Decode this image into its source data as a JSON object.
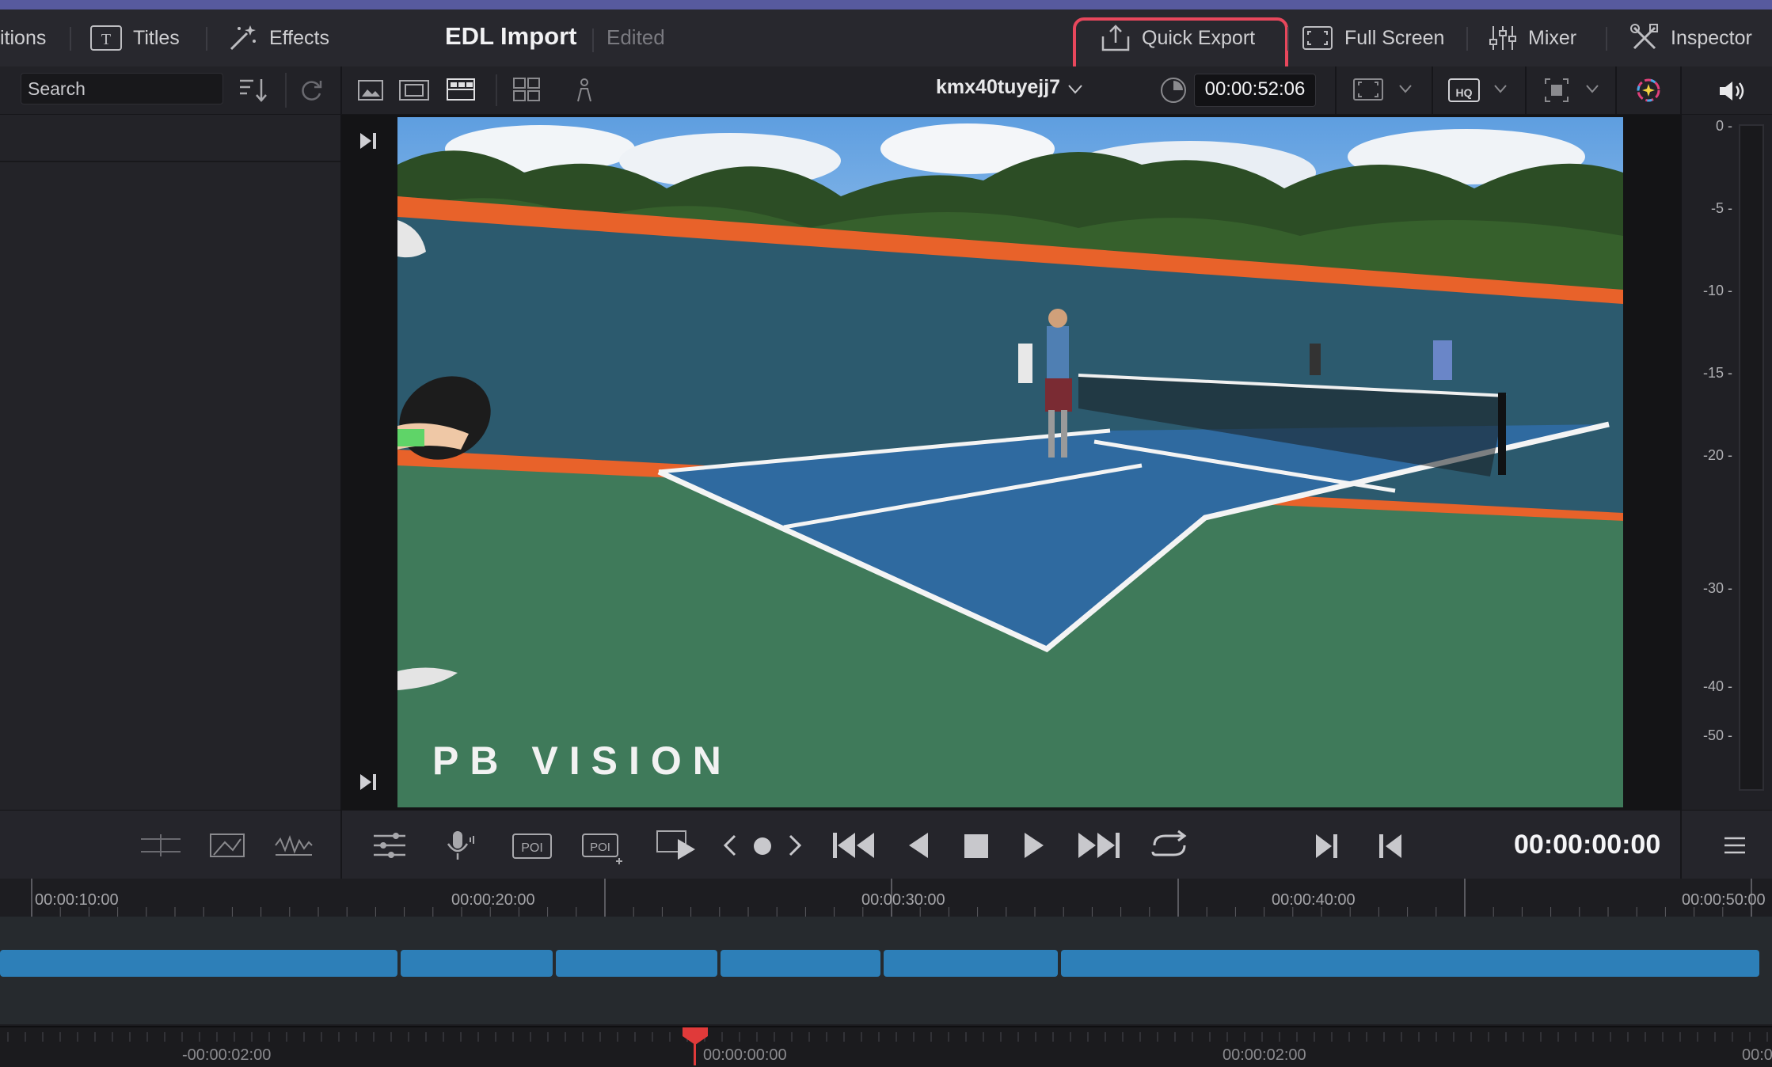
{
  "toolbar": {
    "transitions_label": "itions",
    "titles_label": "Titles",
    "effects_label": "Effects",
    "project_title": "EDL Import",
    "project_state": "Edited",
    "quick_export_label": "Quick Export",
    "full_screen_label": "Full Screen",
    "mixer_label": "Mixer",
    "inspector_label": "Inspector"
  },
  "media": {
    "search_placeholder": "Search"
  },
  "viewer": {
    "clip_name": "kmx40tuyejj7",
    "timecode": "00:00:52:06",
    "watermark": "PB VISION"
  },
  "meter": {
    "labels": [
      "0 -",
      "-5 -",
      "-10 -",
      "-15 -",
      "-20 -",
      "-30 -",
      "-40 -",
      "-50 -"
    ]
  },
  "transport": {
    "timecode": "00:00:00:00"
  },
  "timeline": {
    "ruler_labels": [
      "00:00:10:00",
      "00:00:20:00",
      "00:00:30:00",
      "00:00:40:00",
      "00:00:50:00"
    ],
    "ruler2_labels": [
      "-00:00:02:00",
      "00:00:00:00",
      "00:00:02:00",
      "00:0"
    ]
  },
  "colors": {
    "accent_highlight": "#e8475c",
    "clip_blue": "#2d7fb8",
    "playhead": "#e03a3a"
  }
}
